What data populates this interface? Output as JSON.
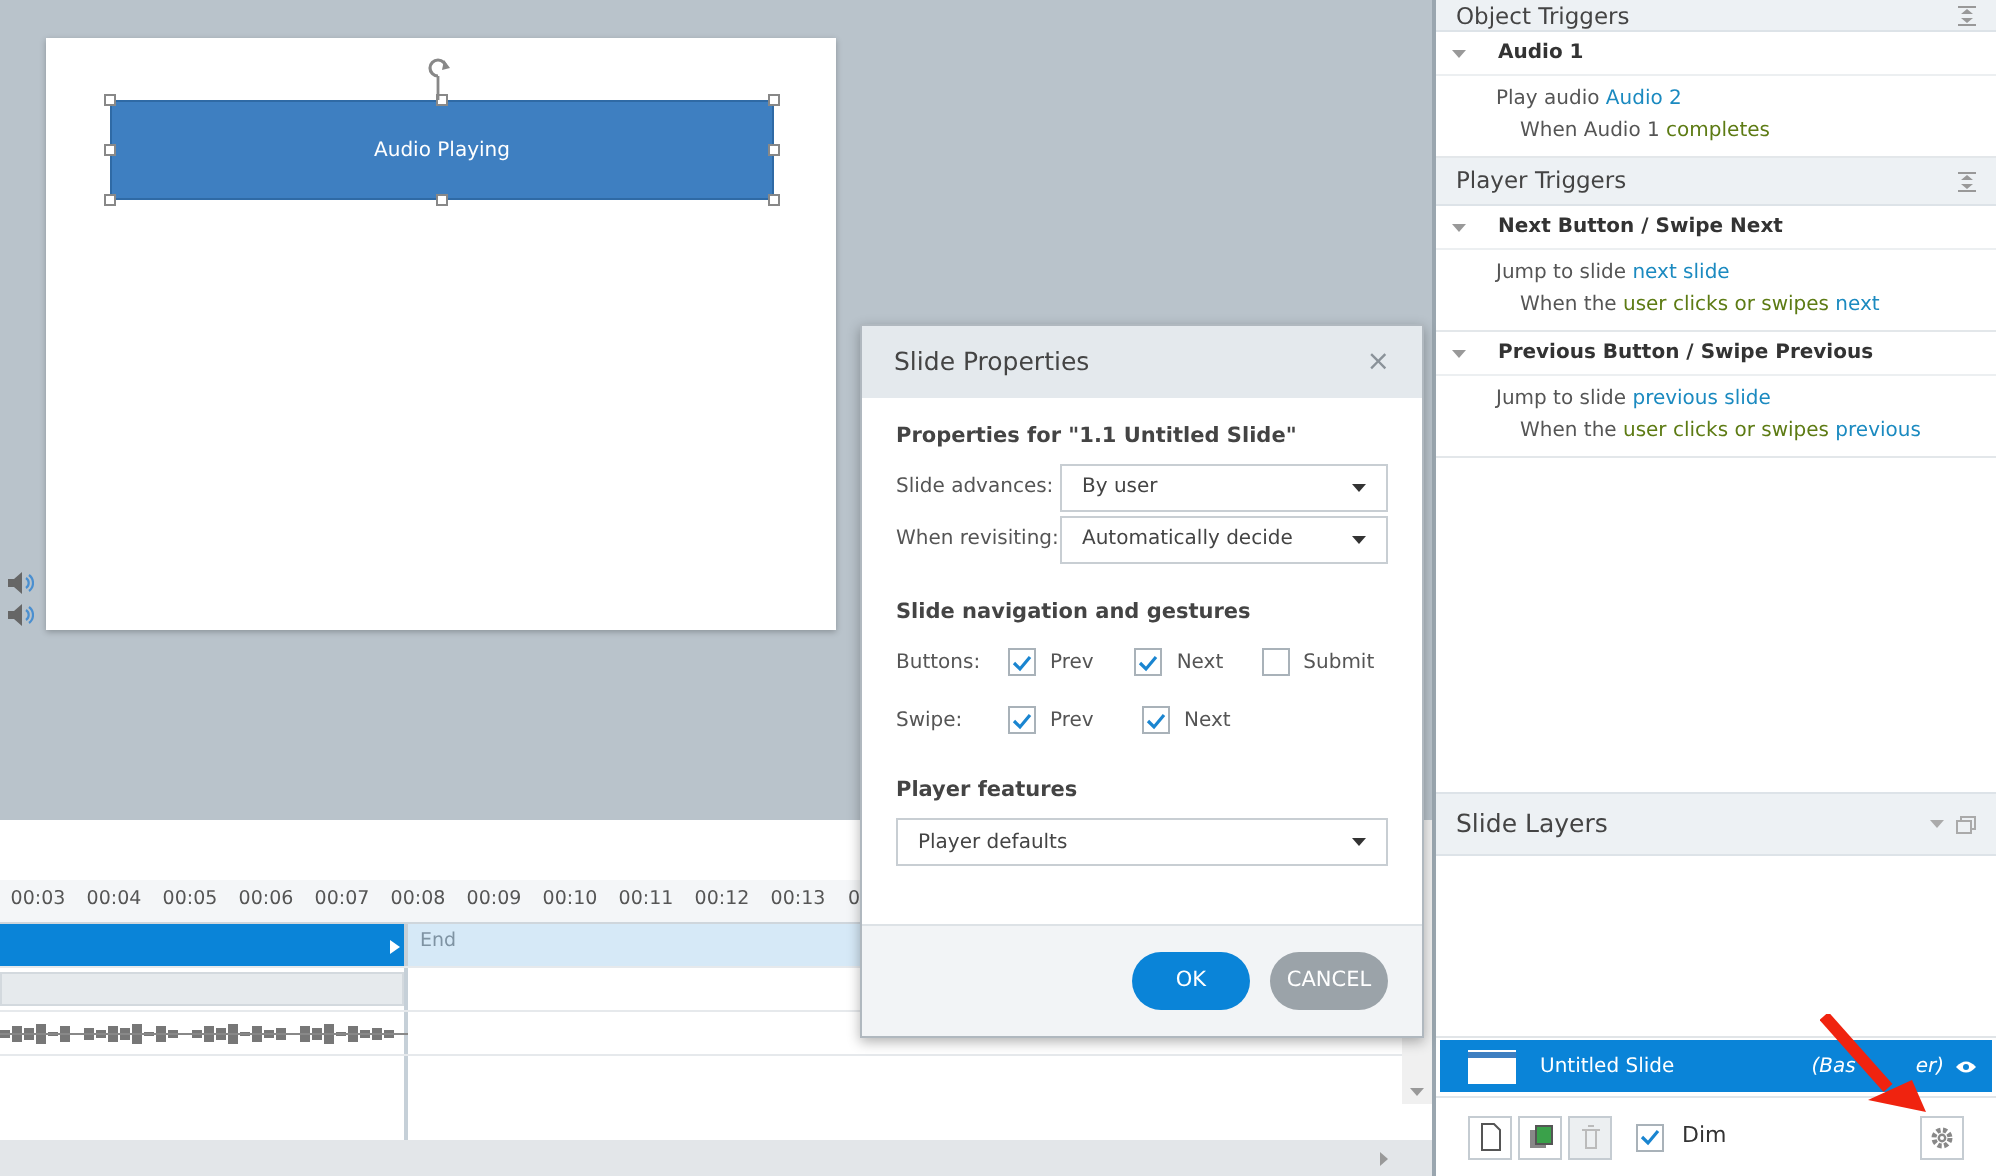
{
  "slide": {
    "shape_label": "Audio Playing",
    "audio_objects": [
      {
        "kind": "speaker"
      },
      {
        "kind": "speaker"
      }
    ]
  },
  "timeline": {
    "ticks": [
      "00:03",
      "00:04",
      "00:05",
      "00:06",
      "00:07",
      "00:08",
      "00:09",
      "00:10",
      "00:11",
      "00:12",
      "00:13",
      "0"
    ],
    "end_label": "End"
  },
  "dialog": {
    "title": "Slide Properties",
    "close": "×",
    "heading": "Properties for \"1.1 Untitled Slide\"",
    "fields": [
      {
        "label": "Slide advances:",
        "value": "By user"
      },
      {
        "label": "When revisiting:",
        "value": "Automatically decide"
      }
    ],
    "nav_heading": "Slide navigation and gestures",
    "check_rows": [
      {
        "label": "Buttons:",
        "items": [
          {
            "label": "Prev",
            "checked": true
          },
          {
            "label": "Next",
            "checked": true
          },
          {
            "label": "Submit",
            "checked": false
          }
        ]
      },
      {
        "label": "Swipe:",
        "items": [
          {
            "label": "Prev",
            "checked": true
          },
          {
            "label": "Next",
            "checked": true
          }
        ]
      }
    ],
    "player_heading": "Player features",
    "player_value": "Player defaults",
    "buttons": [
      {
        "label": "OK",
        "kind": "primary"
      },
      {
        "label": "CANCEL",
        "kind": "secondary"
      }
    ]
  },
  "triggers": {
    "sections": [
      {
        "title": "Object Triggers",
        "groups": [
          {
            "title": "Audio 1",
            "expanded": true,
            "action": [
              {
                "text": "Play audio ",
                "kind": "plain"
              },
              {
                "text": "Audio 2",
                "kind": "link"
              }
            ],
            "condition": [
              {
                "text": "When ",
                "kind": "plain"
              },
              {
                "text": "Audio 1",
                "kind": "plain"
              },
              {
                "text": " completes",
                "kind": "event"
              }
            ]
          }
        ]
      },
      {
        "title": "Player Triggers",
        "groups": [
          {
            "title": "Next Button / Swipe Next",
            "expanded": true,
            "action": [
              {
                "text": "Jump to slide ",
                "kind": "plain"
              },
              {
                "text": "next slide",
                "kind": "link"
              }
            ],
            "condition": [
              {
                "text": "When the ",
                "kind": "plain"
              },
              {
                "text": "user clicks or swipes ",
                "kind": "event"
              },
              {
                "text": "next",
                "kind": "link"
              }
            ]
          },
          {
            "title": "Previous Button / Swipe Previous",
            "expanded": true,
            "action": [
              {
                "text": "Jump to slide ",
                "kind": "plain"
              },
              {
                "text": "previous slide",
                "kind": "link"
              }
            ],
            "condition": [
              {
                "text": "When the ",
                "kind": "plain"
              },
              {
                "text": "user clicks or swipes ",
                "kind": "event"
              },
              {
                "text": "previous",
                "kind": "link"
              }
            ]
          }
        ]
      }
    ]
  },
  "layers": {
    "title": "Slide Layers",
    "items": [
      {
        "name": "Untitled Slide",
        "note": "(Bas",
        "note_end": "er)",
        "selected": true
      }
    ],
    "dim": {
      "label": "Dim",
      "checked": true
    }
  }
}
